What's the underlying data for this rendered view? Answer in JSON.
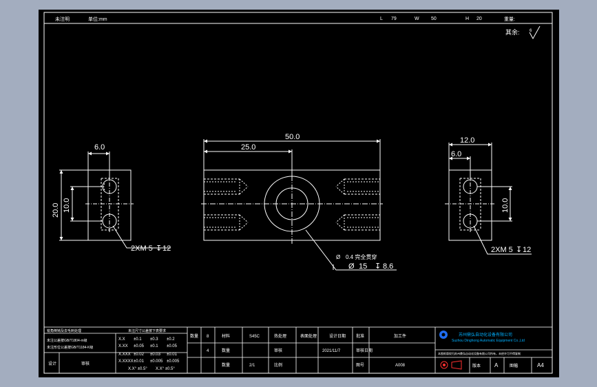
{
  "colors": {
    "background": "#a3adbf",
    "sheet": "#000000",
    "line": "#ffffff",
    "logo": "#1f6cf0",
    "stamp_red": "#ff3030"
  },
  "header": {
    "left_label_1": "未注明",
    "left_label_2": "单位:mm",
    "l_label": "L",
    "l_value": "79",
    "w_label": "W",
    "w_value": "50",
    "h_label": "H",
    "h_value": "20",
    "weight_label": "重量:",
    "note_label": "其余:",
    "roughness_symbol": "√"
  },
  "dimensions": {
    "left_width": "6.0",
    "left_height_total": "20.0",
    "left_height_inner": "10.0",
    "left_holes": "2XM 5",
    "left_holes_depth": "12",
    "front_total": "50.0",
    "front_half": "25.0",
    "front_chamfer": "0.4 完全贯穿",
    "front_bore_dia": "15",
    "front_bore_depth": "8.6",
    "right_width_total": "12.0",
    "right_width_half": "6.0",
    "right_height": "10.0",
    "right_holes": "2XM 5",
    "right_holes_depth": "12",
    "diameter_symbol": "Ø",
    "depth_symbol": "↧"
  },
  "title_block": {
    "left_notes": [
      "锐角倒钝及去毛刺处理",
      "未注公差按GB/T1804-m级",
      "未注形位公差按GB/T1184-K级"
    ],
    "drawn_label": "设计",
    "drawn_value": "审核",
    "tol_title": "未注尺寸公差按下表要求",
    "tol_rows": [
      [
        "X.X",
        "±0.1",
        "±0.3",
        "±0.2"
      ],
      [
        "X.XX",
        "±0.05",
        "±0.1",
        "±0.05"
      ],
      [
        "X.XXX",
        "±0.02",
        "±0.03",
        "±0.01"
      ],
      [
        "X.XXXX",
        "±0.01",
        "±0.005",
        "±0.005"
      ]
    ],
    "tol_footer": [
      "X.X° ±0.5°",
      "X.X° ±0.5°"
    ],
    "cells": {
      "qty_label": "数量",
      "qty_value": "8",
      "material_label": "材料",
      "material_value": "S45C",
      "treat_label": "热处理",
      "process_label": "表面处理",
      "date_label": "设计日期",
      "date_value": "2021/11/7",
      "approve_label": "批准",
      "part_label": "加工件",
      "row2_a": "4",
      "row2_b": "数量",
      "row2_c": "审核",
      "row2_d": "审核日期",
      "row3_a": "数量",
      "row3_b": "2/1",
      "row3_c": "比例",
      "row3_d": "图号",
      "drawing_no": "A008",
      "sheet_label": "版本",
      "rev": "A",
      "size_label": "图幅",
      "size": "A4"
    },
    "company_cn": "苏州鼎弘自动化设备有限公司",
    "company_en": "Suzhou Dinghong Automatic Equipment Co.,Ltd",
    "company_note": "本图纸版权归苏州鼎弘自动化设备有限公司所有，未经许可不得复制"
  }
}
